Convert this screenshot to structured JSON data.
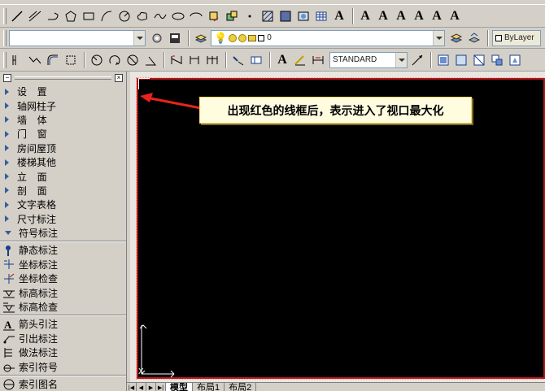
{
  "toolbar_style_combo": {
    "value": "STANDARD"
  },
  "layer_combo": {
    "value": "0"
  },
  "bylayer_combo": {
    "value": "ByLayer"
  },
  "text_tool": {
    "label": "A"
  },
  "text_tools": [
    "A",
    "A",
    "A",
    "A",
    "A",
    "A"
  ],
  "sidebar": {
    "menu": [
      {
        "label": "设置",
        "spaced": true
      },
      {
        "label": "轴网柱子",
        "spaced": false
      },
      {
        "label": "墙体",
        "spaced": true
      },
      {
        "label": "门窗",
        "spaced": true
      },
      {
        "label": "房间屋顶",
        "spaced": false
      },
      {
        "label": "楼梯其他",
        "spaced": false
      },
      {
        "label": "立面",
        "spaced": true
      },
      {
        "label": "剖面",
        "spaced": true
      },
      {
        "label": "文字表格",
        "spaced": false
      },
      {
        "label": "尺寸标注",
        "spaced": false
      },
      {
        "label": "符号标注",
        "spaced": false,
        "open": true
      }
    ],
    "sub_items": [
      {
        "label": "静态标注",
        "icon": "static-mark-icon"
      },
      {
        "label": "坐标标注",
        "icon": "coordinate-icon"
      },
      {
        "label": "坐标检查",
        "icon": "coordinate-check-icon"
      },
      {
        "label": "标高标注",
        "icon": "elevation-icon"
      },
      {
        "label": "标高检查",
        "icon": "elevation-check-icon"
      }
    ],
    "sub_items_2": [
      {
        "label": "箭头引注",
        "icon": "arrow-note-icon"
      },
      {
        "label": "引出标注",
        "icon": "leader-icon"
      },
      {
        "label": "做法标注",
        "icon": "method-icon"
      },
      {
        "label": "索引符号",
        "icon": "index-icon"
      }
    ],
    "sub_items_3": [
      {
        "label": "索引图名",
        "icon": "index-name-icon"
      }
    ]
  },
  "callout": {
    "text": "出现红色的线框后，表示进入了视口最大化"
  },
  "axis_marker": {
    "x_label": "X"
  },
  "tabs": [
    {
      "label": "模型"
    },
    {
      "label": "布局1"
    },
    {
      "label": "布局2"
    }
  ]
}
